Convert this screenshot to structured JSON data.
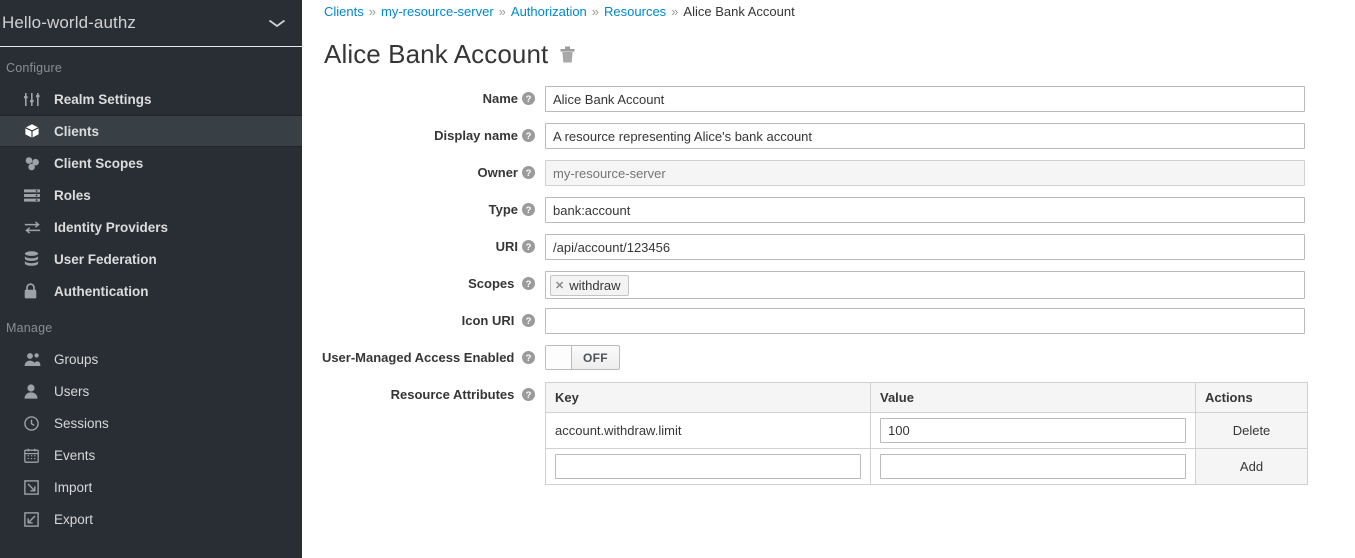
{
  "sidebar": {
    "realm": {
      "name": "Hello-world-authz",
      "chevron_icon": "chevron-down-icon"
    },
    "sections": [
      {
        "title": "Configure",
        "items": [
          {
            "label": "Realm Settings",
            "icon": "sliders-icon",
            "active": false
          },
          {
            "label": "Clients",
            "icon": "cube-icon",
            "active": true
          },
          {
            "label": "Client Scopes",
            "icon": "blocks-icon",
            "active": false
          },
          {
            "label": "Roles",
            "icon": "list-icon",
            "active": false
          },
          {
            "label": "Identity Providers",
            "icon": "exchange-arrows-icon",
            "active": false
          },
          {
            "label": "User Federation",
            "icon": "database-icon",
            "active": false
          },
          {
            "label": "Authentication",
            "icon": "lock-icon",
            "active": false
          }
        ]
      },
      {
        "title": "Manage",
        "items": [
          {
            "label": "Groups",
            "icon": "users-group-icon",
            "active": false
          },
          {
            "label": "Users",
            "icon": "user-icon",
            "active": false
          },
          {
            "label": "Sessions",
            "icon": "clock-icon",
            "active": false
          },
          {
            "label": "Events",
            "icon": "calendar-icon",
            "active": false
          },
          {
            "label": "Import",
            "icon": "import-arrow-icon",
            "active": false
          },
          {
            "label": "Export",
            "icon": "export-arrow-icon",
            "active": false
          }
        ]
      }
    ]
  },
  "breadcrumb": {
    "separator": "»",
    "items": [
      {
        "label": "Clients",
        "link": true
      },
      {
        "label": "my-resource-server",
        "link": true
      },
      {
        "label": "Authorization",
        "link": true
      },
      {
        "label": "Resources",
        "link": true
      },
      {
        "label": "Alice Bank Account",
        "link": false
      }
    ]
  },
  "page": {
    "title": "Alice Bank Account",
    "delete_icon": "trash-icon"
  },
  "form": {
    "help_icon": "question-circle-icon",
    "fields": [
      {
        "label": "Name",
        "value": "Alice Bank Account",
        "placeholder": "",
        "disabled": false,
        "type": "text"
      },
      {
        "label": "Display name",
        "value": "A resource representing Alice's bank account",
        "placeholder": "",
        "disabled": false,
        "type": "text"
      },
      {
        "label": "Owner",
        "value": "",
        "placeholder": "my-resource-server",
        "disabled": true,
        "type": "text"
      },
      {
        "label": "Type",
        "value": "bank:account",
        "placeholder": "",
        "disabled": false,
        "type": "text"
      },
      {
        "label": "URI",
        "value": "/api/account/123456",
        "placeholder": "",
        "disabled": false,
        "type": "text"
      }
    ],
    "scopes": {
      "label": "Scopes",
      "chips": [
        {
          "label": "withdraw",
          "remove_icon": "close-icon"
        }
      ]
    },
    "icon_uri": {
      "label": "Icon URI",
      "value": "",
      "placeholder": ""
    },
    "uma": {
      "label": "User-Managed Access Enabled",
      "state_label": "OFF",
      "enabled": false
    }
  },
  "attributes": {
    "label": "Resource Attributes",
    "columns": [
      "Key",
      "Value",
      "Actions"
    ],
    "rows": [
      {
        "key": "account.withdraw.limit",
        "key_editable": false,
        "value": "100",
        "action": "Delete"
      },
      {
        "key": "",
        "key_editable": true,
        "value": "",
        "action": "Add"
      }
    ]
  },
  "colors": {
    "sidebar_bg": "#292e34",
    "sidebar_active_bg": "#383f45",
    "link": "#0088ce",
    "text": "#363636",
    "muted": "#9b9b9b"
  }
}
